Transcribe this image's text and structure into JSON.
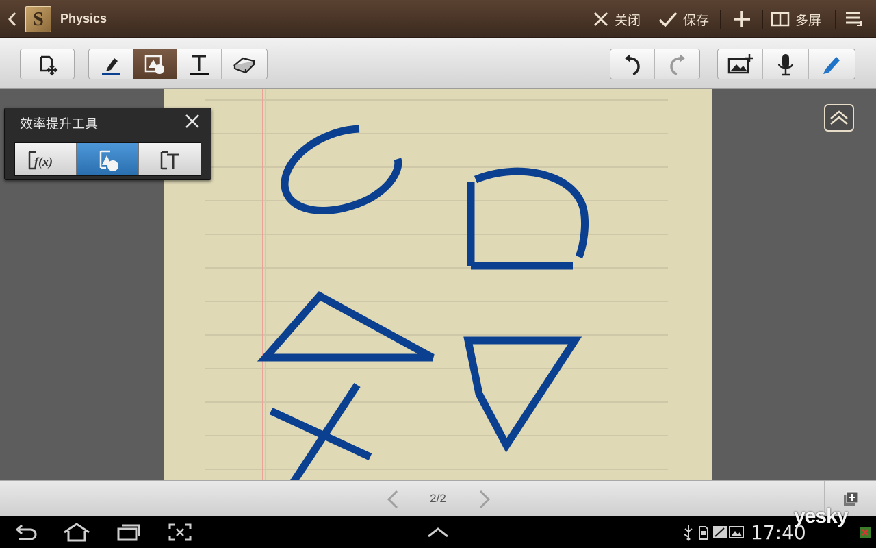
{
  "topbar": {
    "title": "Physics",
    "close_label": "关闭",
    "save_label": "保存",
    "multiscreen_label": "多屏"
  },
  "panel": {
    "title": "效率提升工具",
    "formula_label": "f(x)"
  },
  "pagebar": {
    "page_indicator": "2/2"
  },
  "sysbar": {
    "time": "17:40"
  },
  "watermark": "yesky",
  "colors": {
    "ink": "#0b3f8f",
    "page": "#dfd9b6",
    "topbar": "#4a3426",
    "active_tool": "#6b4c37",
    "active_panel_button": "#3b82c4"
  },
  "icons": {
    "back": "chevron-left-icon",
    "close": "close-icon",
    "save": "check-icon",
    "add": "plus-icon",
    "multiscreen": "split-screen-icon",
    "menu": "menu-icon",
    "page_move": "page-move-icon",
    "pen": "pen-icon",
    "shape": "shape-icon",
    "text": "text-icon",
    "eraser": "eraser-icon",
    "undo": "undo-icon",
    "redo": "redo-icon",
    "insert_image": "insert-image-icon",
    "voice": "microphone-icon",
    "selection": "selection-pen-icon"
  }
}
